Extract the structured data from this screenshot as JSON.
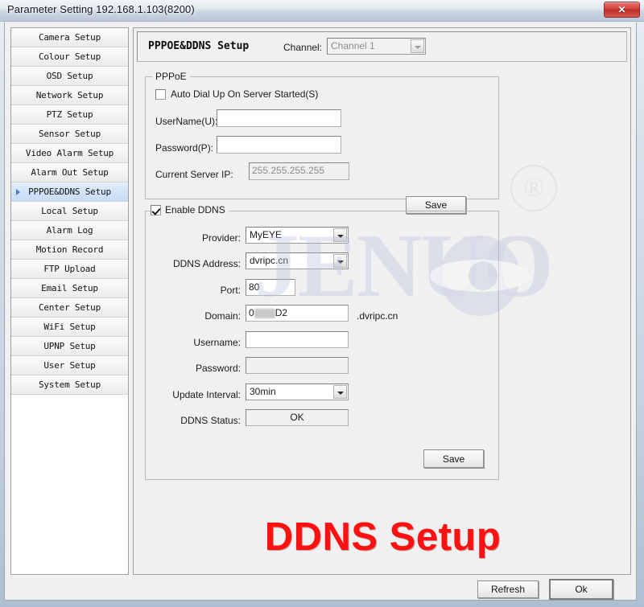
{
  "window": {
    "title": "Parameter Setting 192.168.1.103(8200)",
    "close_label": "✕"
  },
  "sidebar": {
    "items": [
      {
        "label": "Camera Setup",
        "selected": false
      },
      {
        "label": "Colour Setup",
        "selected": false
      },
      {
        "label": "OSD Setup",
        "selected": false
      },
      {
        "label": "Network Setup",
        "selected": false
      },
      {
        "label": "PTZ Setup",
        "selected": false
      },
      {
        "label": "Sensor Setup",
        "selected": false
      },
      {
        "label": "Video Alarm Setup",
        "selected": false
      },
      {
        "label": "Alarm Out Setup",
        "selected": false
      },
      {
        "label": "PPPOE&DDNS Setup",
        "selected": true
      },
      {
        "label": "Local Setup",
        "selected": false
      },
      {
        "label": "Alarm Log",
        "selected": false
      },
      {
        "label": "Motion Record",
        "selected": false
      },
      {
        "label": "FTP Upload",
        "selected": false
      },
      {
        "label": "Email Setup",
        "selected": false
      },
      {
        "label": "Center Setup",
        "selected": false
      },
      {
        "label": "WiFi Setup",
        "selected": false
      },
      {
        "label": "UPNP Setup",
        "selected": false
      },
      {
        "label": "User Setup",
        "selected": false
      },
      {
        "label": "System Setup",
        "selected": false
      }
    ]
  },
  "header": {
    "page_title": "PPPOE&DDNS Setup",
    "channel_label": "Channel:",
    "channel_value": "Channel 1",
    "channel_options": [
      "Channel 1"
    ]
  },
  "pppoe": {
    "legend": "PPPoE",
    "auto_dial_label": "Auto Dial Up On Server Started(S)",
    "auto_dial_checked": false,
    "username_label": "UserName(U):",
    "username_value": "",
    "password_label": "Password(P):",
    "password_value": "",
    "server_ip_label": "Current Server IP:",
    "server_ip_value": "255.255.255.255",
    "save_label": "Save"
  },
  "ddns": {
    "enable_label": "Enable DDNS",
    "enable_checked": true,
    "provider_label": "Provider:",
    "provider_value": "MyEYE",
    "provider_options": [
      "MyEYE"
    ],
    "address_label": "DDNS Address:",
    "address_value": "dvripc.cn",
    "address_options": [
      "dvripc.cn"
    ],
    "port_label": "Port:",
    "port_value": "80",
    "domain_label": "Domain:",
    "domain_prefix": "0",
    "domain_suffix": "D2",
    "domain_tail": ".dvripc.cn",
    "username_label": "Username:",
    "username_value": "",
    "password_label": "Password:",
    "password_value": "",
    "interval_label": "Update Interval:",
    "interval_value": "30min",
    "interval_options": [
      "30min"
    ],
    "status_label": "DDNS Status:",
    "status_value": "OK",
    "save_label": "Save"
  },
  "overlay": {
    "red_text": "DDNS Setup",
    "red_color": "#ff1111"
  },
  "watermark": {
    "brand": "JENUO",
    "registered_mark": "®"
  },
  "footer": {
    "refresh_label": "Refresh",
    "ok_label": "Ok"
  }
}
